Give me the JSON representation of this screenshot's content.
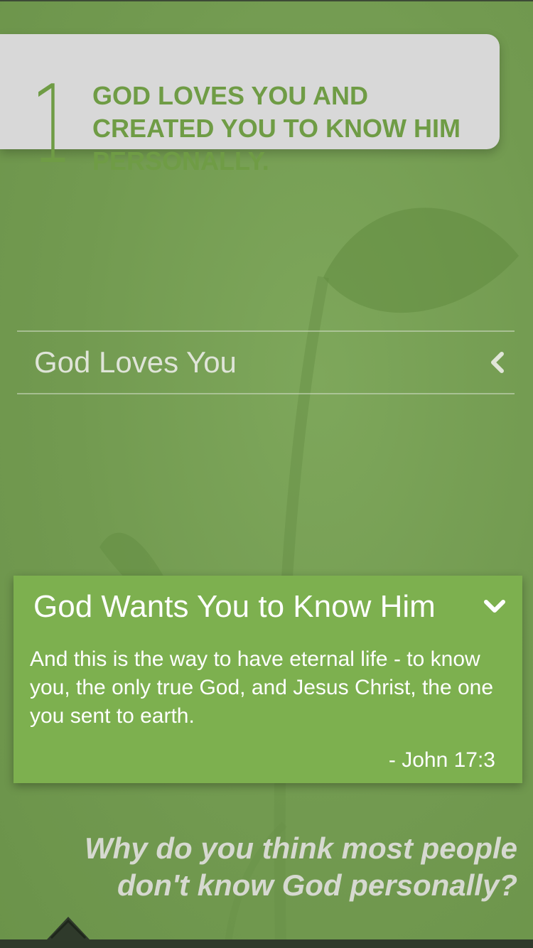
{
  "step": {
    "number": "1",
    "title": "GOD LOVES YOU AND CREATED YOU TO KNOW HIM PERSONALLY."
  },
  "sections": [
    {
      "label": "God Loves You",
      "expanded": false,
      "icon": "chevron-left-icon"
    },
    {
      "label": "God Wants You to Know Him",
      "expanded": true,
      "icon": "chevron-down-icon",
      "body": "And this is the way to have eternal life - to know you, the only true God, and Jesus Christ, the one you sent to earth.",
      "reference": "- John 17:3"
    }
  ],
  "question": "Why do you think most people don't know God personally?",
  "colors": {
    "background": "#749c52",
    "accent": "#6f9c45",
    "panel": "#7db04f",
    "header_card": "#d8d8d8"
  }
}
